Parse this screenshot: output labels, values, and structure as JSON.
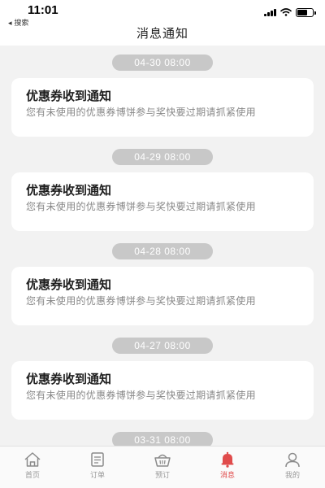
{
  "status_bar": {
    "time": "11:01",
    "back_app": "◂ 搜索"
  },
  "header": {
    "title": "消息通知"
  },
  "notifications": [
    {
      "timestamp": "04-30 08:00",
      "title": "优惠券收到通知",
      "body": "您有未使用的优惠券博饼参与奖快要过期请抓紧使用"
    },
    {
      "timestamp": "04-29 08:00",
      "title": "优惠券收到通知",
      "body": "您有未使用的优惠券博饼参与奖快要过期请抓紧使用"
    },
    {
      "timestamp": "04-28 08:00",
      "title": "优惠券收到通知",
      "body": "您有未使用的优惠券博饼参与奖快要过期请抓紧使用"
    },
    {
      "timestamp": "04-27 08:00",
      "title": "优惠券收到通知",
      "body": "您有未使用的优惠券博饼参与奖快要过期请抓紧使用"
    },
    {
      "timestamp": "03-31 08:00",
      "title": "",
      "body": ""
    }
  ],
  "tab_bar": {
    "items": [
      {
        "label": "首页",
        "icon": "home-icon",
        "active": false
      },
      {
        "label": "订单",
        "icon": "order-icon",
        "active": false
      },
      {
        "label": "预订",
        "icon": "basket-icon",
        "active": false
      },
      {
        "label": "消息",
        "icon": "bell-icon",
        "active": true
      },
      {
        "label": "我的",
        "icon": "user-icon",
        "active": false
      }
    ]
  },
  "colors": {
    "accent": "#e04b4b",
    "background": "#f2f2f2",
    "timestamp_pill": "#c8c8c8"
  }
}
